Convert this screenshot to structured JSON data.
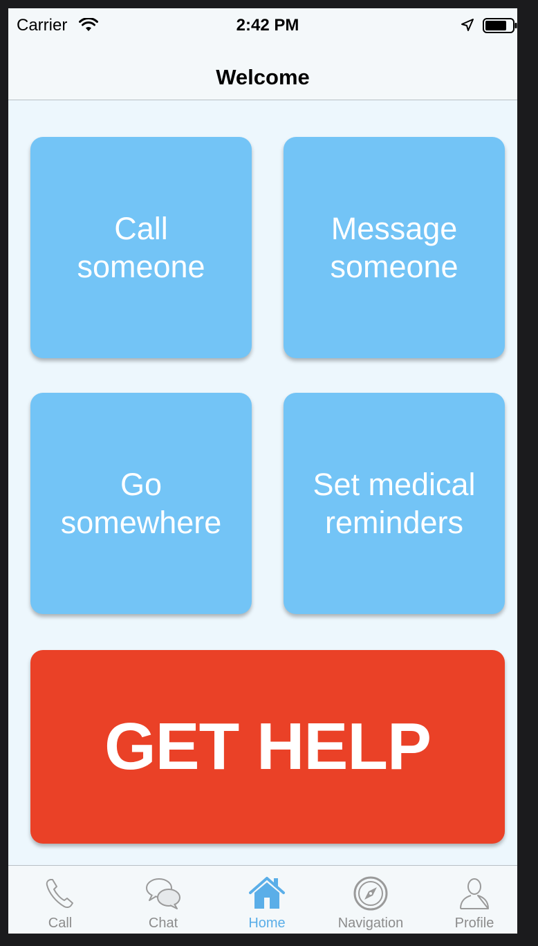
{
  "status_bar": {
    "carrier": "Carrier",
    "time": "2:42 PM"
  },
  "header": {
    "title": "Welcome"
  },
  "tiles": [
    {
      "label": "Call\nsomeone"
    },
    {
      "label": "Message\nsomeone"
    },
    {
      "label": "Go\nsomewhere"
    },
    {
      "label": "Set medical\nreminders"
    }
  ],
  "help_button": {
    "label": "GET HELP"
  },
  "tab_bar": {
    "tabs": [
      {
        "label": "Call",
        "icon": "phone-icon"
      },
      {
        "label": "Chat",
        "icon": "chat-icon"
      },
      {
        "label": "Home",
        "icon": "home-icon",
        "active": true
      },
      {
        "label": "Navigation",
        "icon": "compass-icon"
      },
      {
        "label": "Profile",
        "icon": "profile-icon"
      }
    ]
  },
  "colors": {
    "tile": "#73c4f6",
    "help": "#ea4127",
    "active_tab": "#5aaee8",
    "inactive_tab": "#8c8c8c",
    "background": "#edf7fd"
  }
}
